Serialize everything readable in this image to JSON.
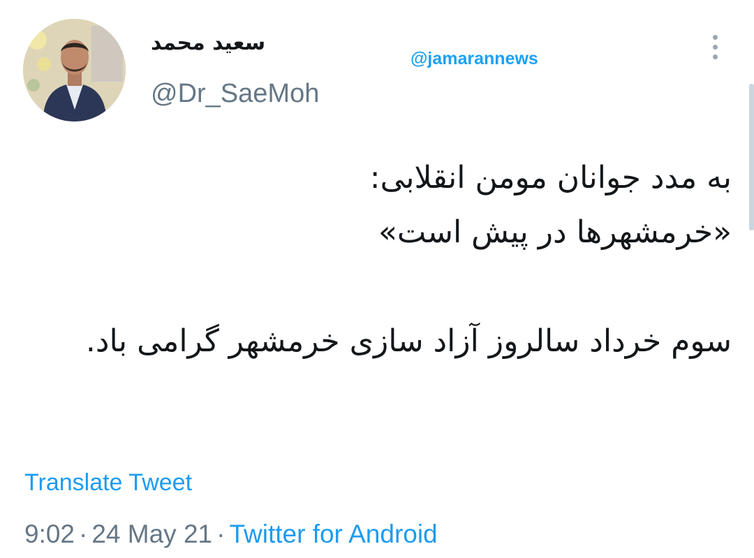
{
  "author": {
    "display_name": "سعید محمد",
    "handle": "@Dr_SaeMoh"
  },
  "watermark": "@jamarannews",
  "tweet": {
    "lines": [
      "به مدد جوانان مومن انقلابی:",
      "«خرمشهرها در پیش است»",
      "سوم خرداد سالروز آزاد سازی خرمشهر گرامی باد."
    ]
  },
  "translate_label": "Translate Tweet",
  "meta": {
    "time": "9:02",
    "separator": "·",
    "date": "24 May 21",
    "source": "Twitter for Android"
  },
  "icons": {
    "more": "more-vertical-icon"
  },
  "colors": {
    "link": "#1d9bf0",
    "muted": "#657786",
    "text": "#14171a"
  }
}
